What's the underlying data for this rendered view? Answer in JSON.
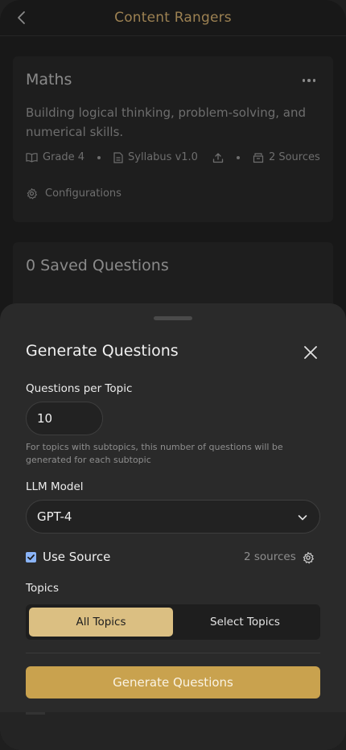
{
  "header": {
    "title": "Content Rangers"
  },
  "subject": {
    "name": "Maths",
    "description": "Building logical thinking, problem-solving, and numerical skills.",
    "meta": {
      "grade": "Grade 4",
      "syllabus": "Syllabus v1.0",
      "sources": "2 Sources"
    },
    "configurations": "Configurations"
  },
  "saved": {
    "title": "0 Saved Questions"
  },
  "sheet": {
    "title": "Generate Questions",
    "questions_per_topic": {
      "label": "Questions per Topic",
      "value": "10",
      "hint": "For topics with subtopics, this number of questions will be generated for each subtopic"
    },
    "llm_model": {
      "label": "LLM Model",
      "value": "GPT-4"
    },
    "use_source": {
      "label": "Use Source",
      "checked": true,
      "count": "2 sources"
    },
    "topics": {
      "label": "Topics",
      "options": [
        "All Topics",
        "Select Topics"
      ],
      "selected": "All Topics"
    },
    "generate_label": "Generate Questions"
  },
  "colors": {
    "accent": "#c9a24e",
    "accent_light": "#dbbf82",
    "checkbox": "#8ab4f8",
    "title_brown": "#9c8152"
  }
}
